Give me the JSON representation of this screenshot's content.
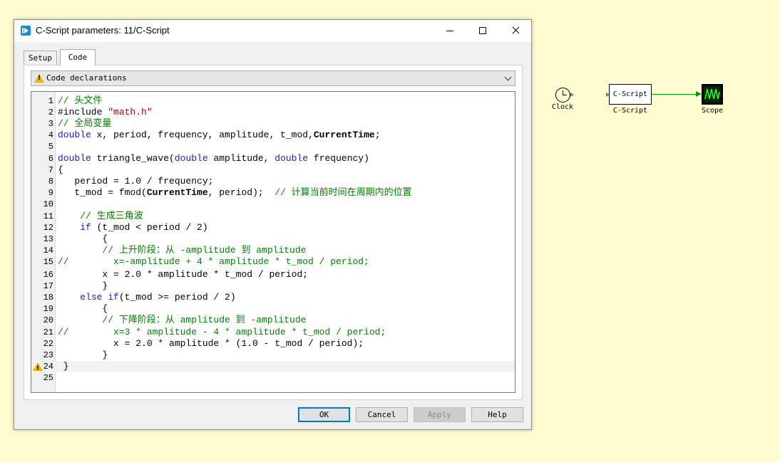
{
  "dialog": {
    "title": "C-Script parameters: 11/C-Script",
    "tabs": [
      "Setup",
      "Code"
    ],
    "section_select": "Code declarations",
    "code_lines": [
      {
        "n": "1",
        "tokens": [
          {
            "t": "// 头文件",
            "c": "cm"
          }
        ]
      },
      {
        "n": "2",
        "tokens": [
          {
            "t": "#include "
          },
          {
            "t": "\"math.h\"",
            "c": "str"
          }
        ]
      },
      {
        "n": "3",
        "tokens": [
          {
            "t": "// 全局变量",
            "c": "cm"
          }
        ]
      },
      {
        "n": "4",
        "tokens": [
          {
            "t": "double",
            "c": "kw"
          },
          {
            "t": " x, period, frequency, amplitude, t_mod,"
          },
          {
            "t": "CurrentTime",
            "c": "bold"
          },
          {
            "t": ";"
          }
        ]
      },
      {
        "n": "5",
        "tokens": []
      },
      {
        "n": "6",
        "tokens": [
          {
            "t": "double",
            "c": "kw"
          },
          {
            "t": " triangle_wave("
          },
          {
            "t": "double",
            "c": "kw"
          },
          {
            "t": " amplitude, "
          },
          {
            "t": "double",
            "c": "kw"
          },
          {
            "t": " frequency)"
          }
        ]
      },
      {
        "n": "7",
        "tokens": [
          {
            "t": "{"
          }
        ]
      },
      {
        "n": "8",
        "tokens": [
          {
            "t": "   period = 1.0 / frequency;"
          }
        ]
      },
      {
        "n": "9",
        "tokens": [
          {
            "t": "   t_mod = fmod("
          },
          {
            "t": "CurrentTime",
            "c": "bold"
          },
          {
            "t": ", period);  "
          },
          {
            "t": "// 计算当前时间在周期内的位置",
            "c": "cm"
          }
        ]
      },
      {
        "n": "10",
        "tokens": []
      },
      {
        "n": "11",
        "tokens": [
          {
            "t": "    "
          },
          {
            "t": "// 生成三角波",
            "c": "cm"
          }
        ]
      },
      {
        "n": "12",
        "tokens": [
          {
            "t": "    "
          },
          {
            "t": "if",
            "c": "kw"
          },
          {
            "t": " (t_mod < period / 2)"
          }
        ]
      },
      {
        "n": "13",
        "tokens": [
          {
            "t": "        {"
          }
        ]
      },
      {
        "n": "14",
        "tokens": [
          {
            "t": "        "
          },
          {
            "t": "// 上升阶段：从 -amplitude 到 amplitude",
            "c": "cm"
          }
        ]
      },
      {
        "n": "15",
        "tokens": [
          {
            "t": "//        x=-amplitude + 4 * amplitude * t_mod / period;",
            "c": "cm"
          }
        ]
      },
      {
        "n": "16",
        "tokens": [
          {
            "t": "        x = 2.0 * amplitude * t_mod / period;"
          }
        ]
      },
      {
        "n": "17",
        "tokens": [
          {
            "t": "        }"
          }
        ]
      },
      {
        "n": "18",
        "tokens": [
          {
            "t": "    "
          },
          {
            "t": "else if",
            "c": "kw"
          },
          {
            "t": "(t_mod >= period / 2)"
          }
        ]
      },
      {
        "n": "19",
        "tokens": [
          {
            "t": "        {"
          }
        ]
      },
      {
        "n": "20",
        "tokens": [
          {
            "t": "        "
          },
          {
            "t": "// 下降阶段：从 amplitude 到 -amplitude",
            "c": "cm"
          }
        ]
      },
      {
        "n": "21",
        "tokens": [
          {
            "t": "//        x=3 * amplitude - 4 * amplitude * t_mod / period;",
            "c": "cm"
          }
        ]
      },
      {
        "n": "22",
        "tokens": [
          {
            "t": "          x = 2.0 * amplitude * (1.0 - t_mod / period);"
          }
        ]
      },
      {
        "n": "23",
        "tokens": [
          {
            "t": "        }"
          }
        ]
      },
      {
        "n": "24",
        "tokens": [
          {
            "t": " }"
          }
        ],
        "warning": true,
        "current": true
      },
      {
        "n": "25",
        "tokens": []
      }
    ],
    "buttons": {
      "ok": "OK",
      "cancel": "Cancel",
      "apply": "Apply",
      "help": "Help"
    }
  },
  "diagram": {
    "clock_label": "Clock",
    "cscript_text": "C-Script",
    "cscript_label": "C-Script",
    "scope_label": "Scope",
    "link_color": "#00a000"
  },
  "colors": {
    "background": "#fffdd0",
    "keyword": "#2020c0",
    "comment": "#008000",
    "string": "#c00000",
    "accent": "#0078d7"
  }
}
